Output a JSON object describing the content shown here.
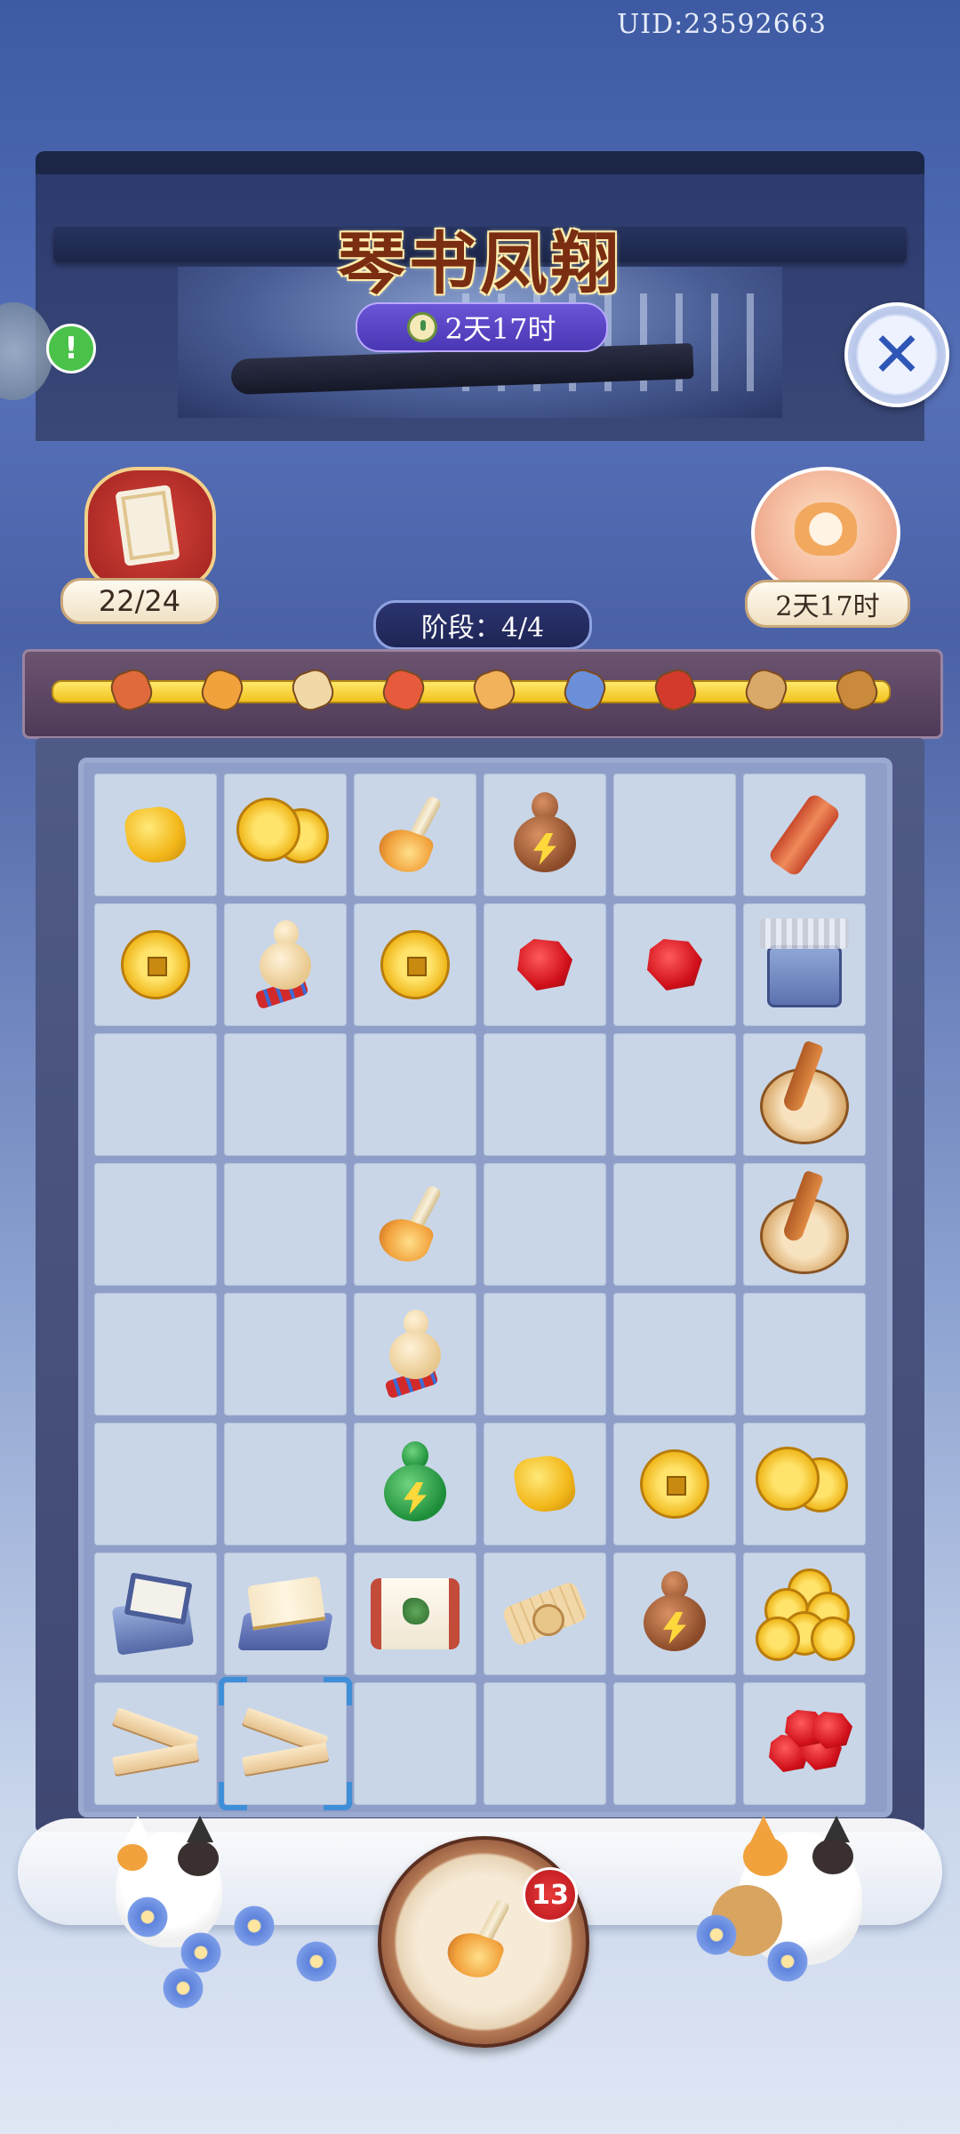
{
  "header": {
    "uid": "UID:23592663",
    "title": "琴书凤翔",
    "event_timer": "2天17时",
    "icons": {
      "timer": "clock-icon",
      "close": "close-icon",
      "alert": "exclamation-icon"
    }
  },
  "left_panel": {
    "counter": "22/24",
    "icon": "task-scroll-icon"
  },
  "right_panel": {
    "timer": "2天17时",
    "icon": "cat-reward-icon"
  },
  "stage": {
    "label": "阶段：4/4"
  },
  "progress": {
    "milestones": [
      "flute-icon",
      "horn-icon",
      "gourd-icon",
      "clappers-icon",
      "panpipe-icon",
      "drum-icon",
      "flute-red-icon",
      "pipa-icon",
      "pipa-disk-icon"
    ]
  },
  "board": {
    "rows": [
      [
        "gold-nugget",
        "coin-pair",
        "horn",
        "bolt-gourd-brown",
        "empty",
        "flute"
      ],
      [
        "coin",
        "ivory-gourd",
        "coin",
        "ruby",
        "ruby",
        "box-stack"
      ],
      [
        "empty",
        "empty",
        "empty",
        "empty",
        "empty",
        "pipa-disk"
      ],
      [
        "empty",
        "empty",
        "horn",
        "empty",
        "empty",
        "pipa-disk"
      ],
      [
        "empty",
        "empty",
        "ivory-gourd",
        "empty",
        "empty",
        "empty"
      ],
      [
        "empty",
        "empty",
        "bolt-gourd-green",
        "gold-nugget",
        "coin",
        "coin-pair"
      ],
      [
        "mini-book",
        "open-book",
        "scroll",
        "bamboo-scroll",
        "bolt-gourd-brown",
        "coin-heap"
      ],
      [
        "planks",
        "planks-selected",
        "empty",
        "empty",
        "empty",
        "ruby-pile"
      ]
    ]
  },
  "bottom": {
    "summon_badge": "13",
    "summon_icon": "horn-icon"
  },
  "colors": {
    "background_top": "#3d5aa3",
    "title_color": "#7a2d10",
    "pill_purple": "#5a45c4",
    "badge_red": "#d0242a",
    "cell": "#c9d6e8"
  }
}
